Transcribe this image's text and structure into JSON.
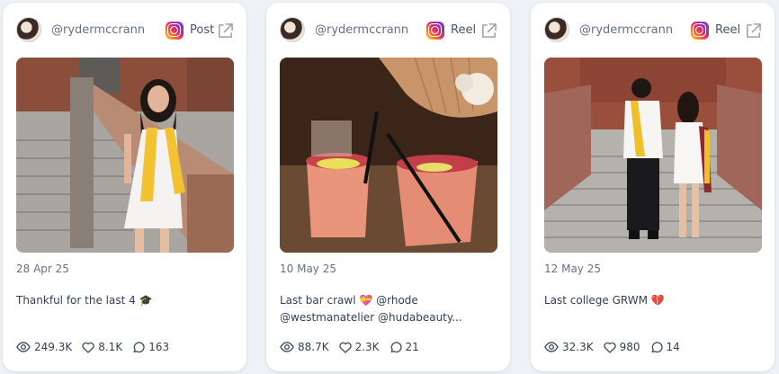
{
  "posts": [
    {
      "username": "@rydermccrann",
      "platform_icon": "instagram-icon",
      "type": "Post",
      "date": "28 Apr 25",
      "caption_lines": [
        "Thankful for the last 4 🎓"
      ],
      "views": "249.3K",
      "likes": "8.1K",
      "comments": "163"
    },
    {
      "username": "@rydermccrann",
      "platform_icon": "instagram-icon",
      "type": "Reel",
      "date": "10 May 25",
      "caption_lines": [
        "Last bar crawl 💝 @rhode",
        "@westmanatelier @hudabeauty..."
      ],
      "views": "88.7K",
      "likes": "2.3K",
      "comments": "21"
    },
    {
      "username": "@rydermccrann",
      "platform_icon": "instagram-icon",
      "type": "Reel",
      "date": "12 May 25",
      "caption_lines": [
        "Last college GRWM 💔"
      ],
      "views": "32.3K",
      "likes": "980",
      "comments": "14"
    }
  ],
  "colors": {
    "card_background": "#ffffff",
    "page_background": "#eef2f6",
    "muted_text": "#667085"
  }
}
